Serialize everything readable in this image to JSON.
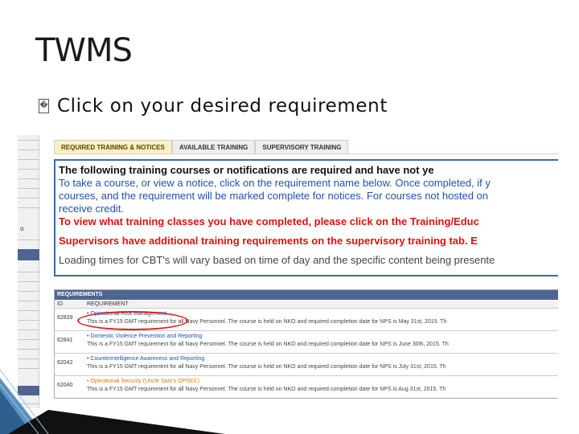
{
  "slide": {
    "title": "TWMS",
    "bullet_glyph": "�",
    "bullet_text": "Click on your desired requirement"
  },
  "tabs": [
    {
      "label": "REQUIRED TRAINING & NOTICES",
      "active": true
    },
    {
      "label": "AVAILABLE TRAINING",
      "active": false
    },
    {
      "label": "SUPERVISORY TRAINING",
      "active": false
    }
  ],
  "notice": {
    "line1": "The following training courses or notifications are required and have not ye",
    "line2": "To take a course, or view a notice, click on the requirement name below. Once completed, if y",
    "line3": "courses, and the requirement will be marked complete for notices. For courses not hosted on",
    "line4": "receive credit.",
    "line5": "To view what training classes you have completed, please click on the Training/Educ",
    "line6": "Supervisors have additional training requirements on the supervisory training tab. E",
    "line7": "Loading times for CBT's will vary based on time of day and the specific content being presente"
  },
  "requirements": {
    "header": "REQUIREMENTS",
    "col_id": "ID",
    "col_req": "REQUIREMENT",
    "rows": [
      {
        "id": "62839",
        "title": "Operational Risk Management",
        "desc": "This is a FY15 GMT requirement for all Navy Personnel. The course is held on NKO and required completion date for NPS is May 31st, 2015. Th"
      },
      {
        "id": "62841",
        "title": "Domestic Violence Prevention and Reporting",
        "desc": "This is a FY15 GMT requirement for all Navy Personnel. The course is held on NKO and required completion date for NPS is June 30th, 2015. Th"
      },
      {
        "id": "62042",
        "title": "Counterintelligence Awareness and Reporting",
        "desc": "This is a FY15 GMT requirement for all Navy Personnel. The course is held on NKO and required completion date for NPS is July 31st, 2015. Th"
      },
      {
        "id": "62040",
        "title": "Operational Security (Uncle Sam's OPSEC)",
        "desc": "This is a FY15 GMT requirement for all Navy Personnel. The course is held on NKO and required completion date for NPS is Aug 31st, 2015. Th"
      }
    ]
  },
  "sidebar_marker": "o",
  "colors": {
    "accent_blue": "#1e52b0",
    "alert_red": "#e01010",
    "header_navy": "#4e6591",
    "active_tab": "#f9f0c6",
    "opsec_orange": "#d97b00"
  }
}
